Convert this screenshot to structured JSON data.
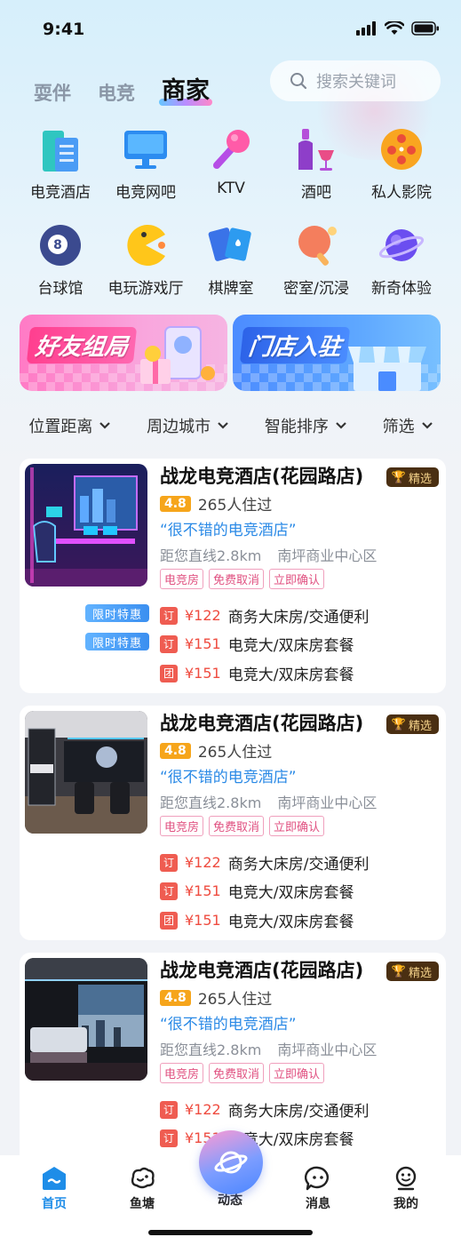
{
  "status": {
    "time": "9:41"
  },
  "tabs": [
    {
      "label": "耍伴",
      "active": false
    },
    {
      "label": "电竞",
      "active": false
    },
    {
      "label": "商家",
      "active": true
    }
  ],
  "search": {
    "placeholder": "搜索关键词"
  },
  "categories": [
    {
      "label": "电竞酒店",
      "icon": "building-icon"
    },
    {
      "label": "电竞网吧",
      "icon": "monitor-icon"
    },
    {
      "label": "KTV",
      "icon": "microphone-icon"
    },
    {
      "label": "酒吧",
      "icon": "wine-icon"
    },
    {
      "label": "私人影院",
      "icon": "film-reel-icon"
    },
    {
      "label": "台球馆",
      "icon": "billiard-ball-icon"
    },
    {
      "label": "电玩游戏厅",
      "icon": "pacman-icon"
    },
    {
      "label": "棋牌室",
      "icon": "cards-icon"
    },
    {
      "label": "密室/沉浸",
      "icon": "ping-pong-icon"
    },
    {
      "label": "新奇体验",
      "icon": "planet-icon"
    }
  ],
  "banners": {
    "left": {
      "title": "好友组局"
    },
    "right": {
      "title": "门店入驻"
    }
  },
  "filters": [
    "位置距离",
    "周边城市",
    "智能排序",
    "筛选"
  ],
  "listings": [
    {
      "title": "战龙电竞酒店(花园路店)",
      "badge": "精选",
      "rating": "4.8",
      "stayed": "265人住过",
      "quote": "“很不错的电竞酒店”",
      "distance": "距您直线2.8km",
      "area": "南坪商业中心区",
      "tags": [
        "电竞房",
        "免费取消",
        "立即确认"
      ],
      "deals": [
        {
          "icon": "订",
          "price": "¥122",
          "name": "商务大床房/交通便利",
          "promo": "限时特惠"
        },
        {
          "icon": "订",
          "price": "¥151",
          "name": "电竞大/双床房套餐",
          "promo": "限时特惠"
        },
        {
          "icon": "团",
          "price": "¥151",
          "name": "电竞大/双床房套餐",
          "promo": ""
        }
      ]
    },
    {
      "title": "战龙电竞酒店(花园路店)",
      "badge": "精选",
      "rating": "4.8",
      "stayed": "265人住过",
      "quote": "“很不错的电竞酒店”",
      "distance": "距您直线2.8km",
      "area": "南坪商业中心区",
      "tags": [
        "电竞房",
        "免费取消",
        "立即确认"
      ],
      "deals": [
        {
          "icon": "订",
          "price": "¥122",
          "name": "商务大床房/交通便利",
          "promo": ""
        },
        {
          "icon": "订",
          "price": "¥151",
          "name": "电竞大/双床房套餐",
          "promo": ""
        },
        {
          "icon": "团",
          "price": "¥151",
          "name": "电竞大/双床房套餐",
          "promo": ""
        }
      ]
    },
    {
      "title": "战龙电竞酒店(花园路店)",
      "badge": "精选",
      "rating": "4.8",
      "stayed": "265人住过",
      "quote": "“很不错的电竞酒店”",
      "distance": "距您直线2.8km",
      "area": "南坪商业中心区",
      "tags": [
        "电竞房",
        "免费取消",
        "立即确认"
      ],
      "deals": [
        {
          "icon": "订",
          "price": "¥122",
          "name": "商务大床房/交通便利",
          "promo": ""
        },
        {
          "icon": "订",
          "price": "¥151",
          "name": "电竞大/双床房套餐",
          "promo": ""
        }
      ]
    }
  ],
  "bottom_nav": [
    {
      "label": "首页",
      "icon": "home-icon",
      "active": true
    },
    {
      "label": "鱼塘",
      "icon": "pond-icon",
      "active": false
    },
    {
      "label": "动态",
      "icon": "planet-icon",
      "active": false
    },
    {
      "label": "消息",
      "icon": "message-icon",
      "active": false
    },
    {
      "label": "我的",
      "icon": "profile-icon",
      "active": false
    }
  ],
  "colors": {
    "accent": "#1e8de8",
    "price": "#ef4c40",
    "quote": "#2b8ae6",
    "rating": "#f6a51b"
  }
}
